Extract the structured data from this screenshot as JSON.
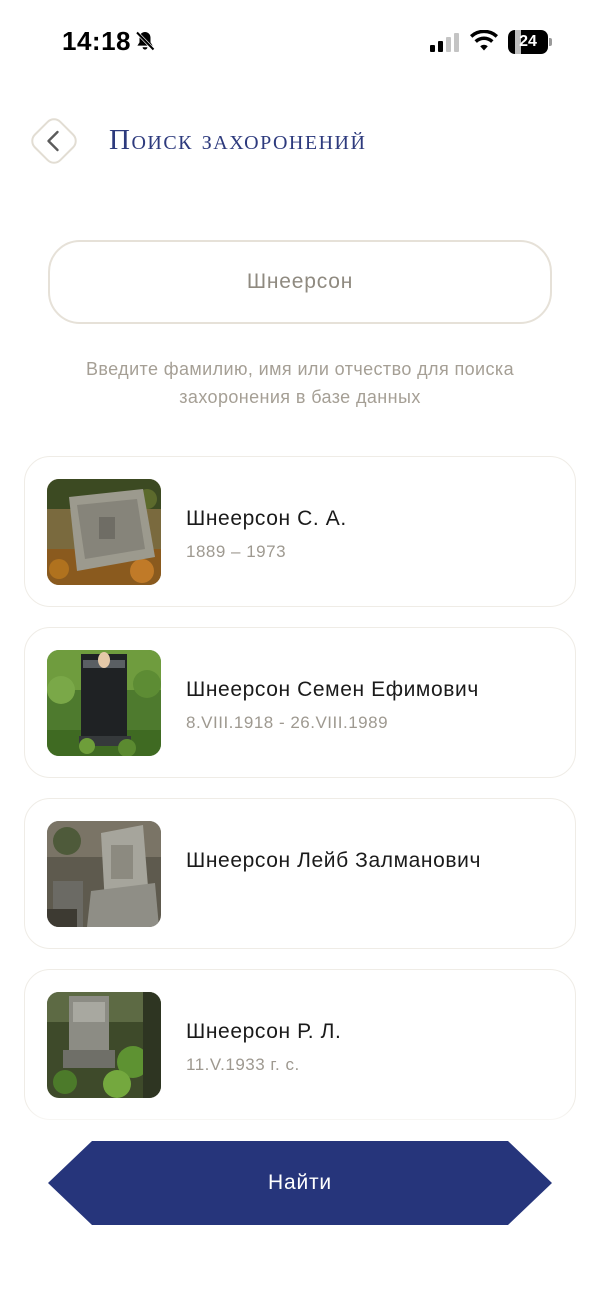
{
  "status_bar": {
    "time": "14:18",
    "battery": "24",
    "battery_level": 0.24
  },
  "header": {
    "title": "Поиск захоронений"
  },
  "search": {
    "value": "Шнеерсон",
    "hint": "Введите фамилию, имя или отчество для поиска захоронения в базе данных"
  },
  "results": [
    {
      "name": "Шнеерсон С. А.",
      "dates": "1889 – 1973"
    },
    {
      "name": "Шнеерсон Семен Ефимович",
      "dates": "8.VIII.1918 - 26.VIII.1989"
    },
    {
      "name": "Шнеерсон Лейб Залманович",
      "dates": ""
    },
    {
      "name": "Шнеерсон Р. Л.",
      "dates": "11.V.1933 г. с."
    }
  ],
  "actions": {
    "find_label": "Найти"
  },
  "colors": {
    "accent": "#26357b",
    "title": "#2d3a7d",
    "border": "#e6e1d8",
    "muted": "#9e9990"
  }
}
